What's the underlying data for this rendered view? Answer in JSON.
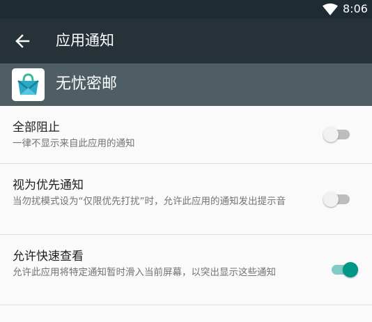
{
  "status_bar": {
    "time": "8:06",
    "icons": [
      "wifi-icon"
    ]
  },
  "app_bar": {
    "title": "应用通知",
    "back_icon": "arrow-left-icon"
  },
  "app_header": {
    "app_name": "无忧密邮",
    "app_icon": "mail-bag-icon"
  },
  "settings": [
    {
      "title": "全部阻止",
      "summary": "一律不显示来自此应用的通知",
      "enabled": false
    },
    {
      "title": "视为优先通知",
      "summary": "当勿扰模式设为“仅限优先打扰”时，允许此应用的通知发出提示音",
      "enabled": false
    },
    {
      "title": "允许快速查看",
      "summary": "允许此应用将特定通知暂时滑入当前屏幕，以突出显示这些通知",
      "enabled": true
    }
  ],
  "colors": {
    "status_bar": "#1f2b32",
    "app_bar": "#263238",
    "app_header": "#4f5e65",
    "accent": "#009688",
    "background": "#fafafa"
  }
}
